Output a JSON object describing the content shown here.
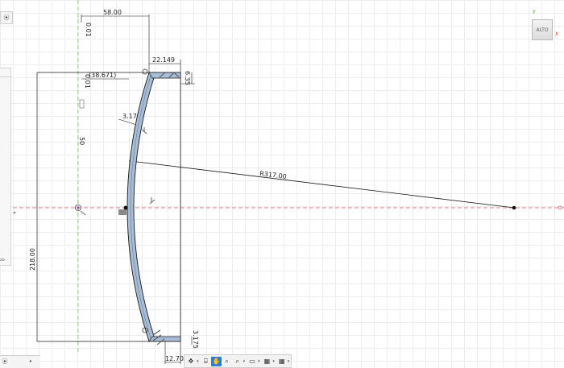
{
  "viewcube": {
    "face_label": "ALTO",
    "axis_y": "Y",
    "axis_x": "X"
  },
  "dimensions": {
    "top_width": "58.00",
    "offset_ref": "(38.671)",
    "right_offset": "22.149",
    "thickness": "3.175",
    "top_small": "6.35",
    "radius": "R317.00",
    "height_total": "218.00",
    "mid_height": "50",
    "top_left_vertical": "0.01",
    "bottom_small": "3.175",
    "bottom_width": "12.70"
  },
  "side_panel": {
    "label": "zo"
  },
  "toolbar": {
    "buttons": [
      "✥",
      "⌸",
      "✋",
      "⌕",
      "⌕",
      "▭",
      "▦",
      "▦"
    ]
  },
  "colors": {
    "grid": "#e9edf0",
    "sketch_line": "#1a1a1a",
    "profile_fill": "#a9bed6",
    "axis_red": "#d9534f",
    "axis_green": "#7dbb50",
    "accent": "#2a7fd4"
  }
}
